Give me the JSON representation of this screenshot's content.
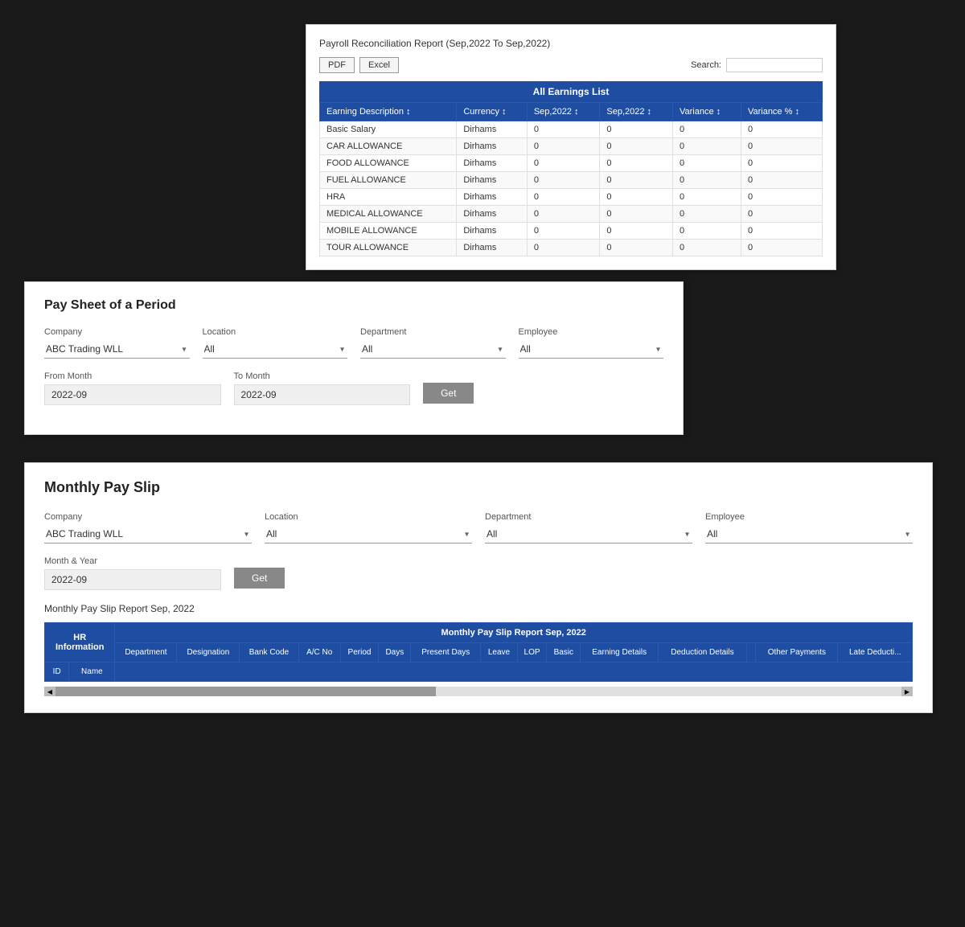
{
  "panel1": {
    "title": "Payroll Reconciliation Report (Sep,2022 To Sep,2022)",
    "buttons": {
      "pdf": "PDF",
      "excel": "Excel"
    },
    "search_label": "Search:",
    "table_header": "All Earnings List",
    "columns": [
      "Earning Description",
      "Currency",
      "Sep,2022",
      "Sep,2022",
      "Variance",
      "Variance %"
    ],
    "rows": [
      [
        "Basic Salary",
        "Dirhams",
        "0",
        "0",
        "0",
        "0"
      ],
      [
        "CAR ALLOWANCE",
        "Dirhams",
        "0",
        "0",
        "0",
        "0"
      ],
      [
        "FOOD ALLOWANCE",
        "Dirhams",
        "0",
        "0",
        "0",
        "0"
      ],
      [
        "FUEL ALLOWANCE",
        "Dirhams",
        "0",
        "0",
        "0",
        "0"
      ],
      [
        "HRA",
        "Dirhams",
        "0",
        "0",
        "0",
        "0"
      ],
      [
        "MEDICAL ALLOWANCE",
        "Dirhams",
        "0",
        "0",
        "0",
        "0"
      ],
      [
        "MOBILE ALLOWANCE",
        "Dirhams",
        "0",
        "0",
        "0",
        "0"
      ],
      [
        "TOUR ALLOWANCE",
        "Dirhams",
        "0",
        "0",
        "0",
        "0"
      ]
    ]
  },
  "panel2": {
    "title": "Pay Sheet of a Period",
    "company_label": "Company",
    "company_value": "ABC Trading WLL",
    "location_label": "Location",
    "location_value": "All",
    "department_label": "Department",
    "department_value": "All",
    "employee_label": "Employee",
    "employee_value": "All",
    "from_month_label": "From Month",
    "from_month_value": "2022-09",
    "to_month_label": "To Month",
    "to_month_value": "2022-09",
    "get_button": "Get"
  },
  "panel3": {
    "title": "Monthly Pay Slip",
    "company_label": "Company",
    "company_value": "ABC Trading WLL",
    "location_label": "Location",
    "location_value": "All",
    "department_label": "Department",
    "department_value": "All",
    "employee_label": "Employee",
    "employee_value": "All",
    "month_year_label": "Month & Year",
    "month_year_value": "2022-09",
    "get_button": "Get",
    "sub_report_title": "Monthly Pay Slip Report Sep, 2022",
    "hr_info_label": "HR Information",
    "report_span_label": "Monthly Pay Slip Report Sep, 2022",
    "columns": [
      "ID",
      "Name",
      "Department",
      "Designation",
      "Bank Code",
      "A/C No",
      "Period",
      "Days",
      "Present Days",
      "Leave",
      "LOP",
      "Basic",
      "Earning Details",
      "Deduction Details",
      "",
      "Other Payments",
      "Late Deducti..."
    ]
  }
}
